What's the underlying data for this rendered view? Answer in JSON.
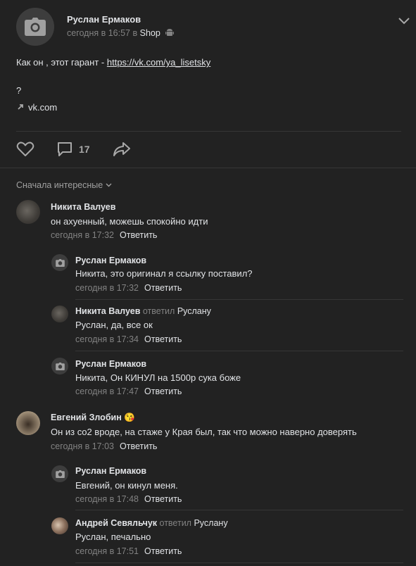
{
  "post": {
    "author": "Руслан Ермаков",
    "time": "сегодня в 16:57 в",
    "group": "Shop",
    "text_prefix": "Как он , этот гарант - ",
    "link": "https://vk.com/ya_lisetsky",
    "text_line2": "?",
    "link_snippet": "vk.com",
    "comments_count": "17"
  },
  "sort_label": "Сначала интересные",
  "comments": [
    {
      "id": "c1",
      "author": "Никита Валуев",
      "text": "он ахуенный, можешь спокойно идти",
      "time": "сегодня в 17:32",
      "reply": "Ответить"
    },
    {
      "id": "c2",
      "author": "Руслан Ермаков",
      "text": "Никита, это оригинал я ссылку поставил?",
      "time": "сегодня в 17:32",
      "reply": "Ответить"
    },
    {
      "id": "c3",
      "author": "Никита Валуев",
      "replied": "ответил",
      "to": "Руслану",
      "text": "Руслан, да, все ок",
      "time": "сегодня в 17:34",
      "reply": "Ответить"
    },
    {
      "id": "c4",
      "author": "Руслан Ермаков",
      "text": "Никита, Он КИНУЛ на 1500р сука боже",
      "time": "сегодня в 17:47",
      "reply": "Ответить"
    },
    {
      "id": "c5",
      "author": "Евгений Злобин",
      "emoji": "😘",
      "text": "Он из co2 вроде, на стаже у Края был, так что можно наверно доверять",
      "time": "сегодня в 17:03",
      "reply": "Ответить"
    },
    {
      "id": "c6",
      "author": "Руслан Ермаков",
      "text": "Евгений, он кинул меня.",
      "time": "сегодня в 17:48",
      "reply": "Ответить"
    },
    {
      "id": "c7",
      "author": "Андрей Севяльчук",
      "replied": "ответил",
      "to": "Руслану",
      "text": "Руслан, печально",
      "time": "сегодня в 17:51",
      "reply": "Ответить"
    }
  ],
  "colors": {
    "background": "#222222",
    "text": "#e1e3e6",
    "muted": "#828282",
    "divider": "#363636"
  }
}
